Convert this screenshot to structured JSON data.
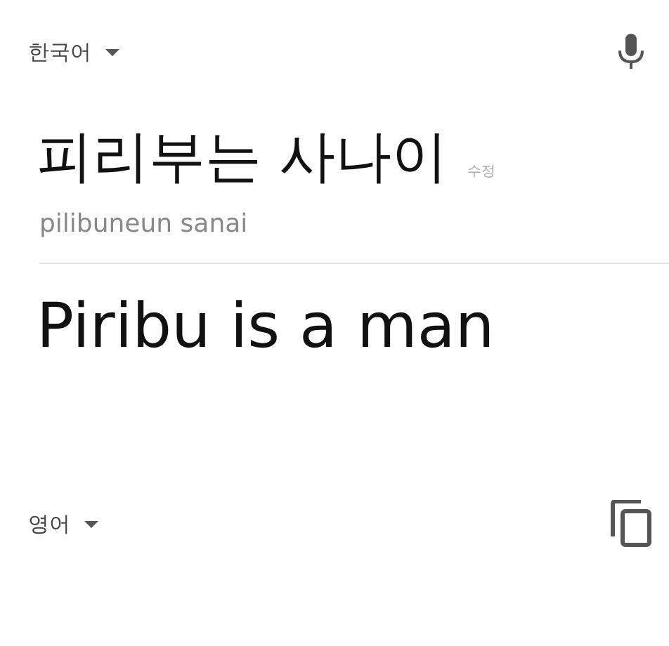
{
  "source": {
    "language": "한국어",
    "text": "피리부는 사나이",
    "edit_label": "수정",
    "romanization": "pilibuneun sanai"
  },
  "target": {
    "language": "영어",
    "text": "Piribu is a man"
  }
}
